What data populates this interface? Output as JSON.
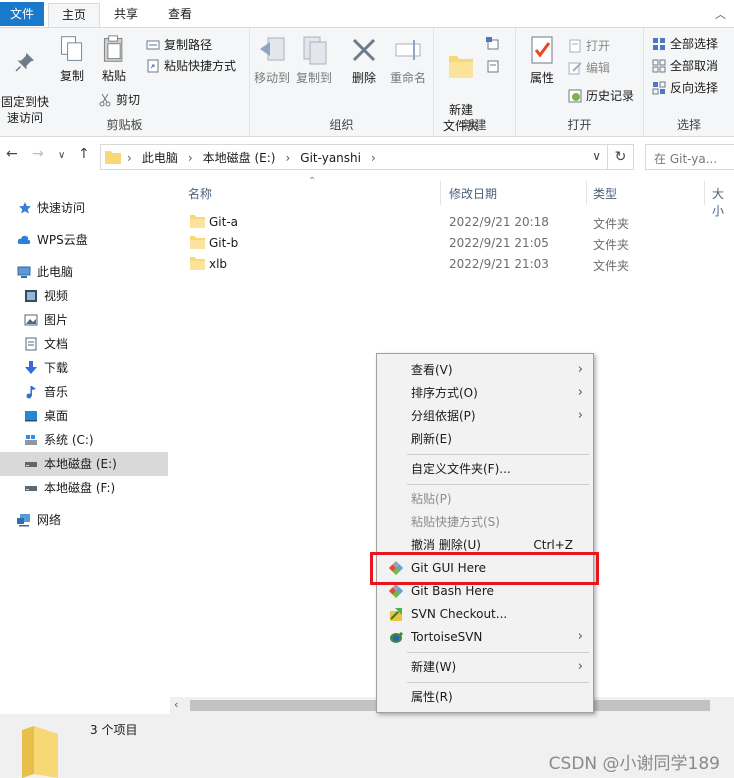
{
  "tabs": {
    "file": "文件",
    "home": "主页",
    "share": "共享",
    "view": "查看"
  },
  "ribbon": {
    "clipboard": {
      "label": "剪贴板",
      "pin": "固定到快\n速访问",
      "copy": "复制",
      "paste": "粘贴",
      "copy_path": "复制路径",
      "paste_shortcut": "粘贴快捷方式",
      "cut": "剪切"
    },
    "organize": {
      "label": "组织",
      "move_to": "移动到",
      "copy_to": "复制到",
      "delete": "删除",
      "rename": "重命名"
    },
    "new": {
      "label": "新建",
      "new_folder": "新建\n文件夹"
    },
    "open": {
      "label": "打开",
      "properties": "属性",
      "open": "打开",
      "edit": "编辑",
      "history": "历史记录"
    },
    "select": {
      "label": "选择",
      "select_all": "全部选择",
      "select_none": "全部取消",
      "invert": "反向选择"
    }
  },
  "address": {
    "crumbs": [
      "此电脑",
      "本地磁盘 (E:)",
      "Git-yanshi"
    ],
    "search_placeholder": "在 Git-ya..."
  },
  "sidebar": {
    "items": [
      {
        "label": "快速访问",
        "icon": "star-icon"
      },
      {
        "label": "WPS云盘",
        "icon": "cloud-icon"
      },
      {
        "label": "此电脑",
        "icon": "computer-icon"
      },
      {
        "label": "视频",
        "icon": "video-icon"
      },
      {
        "label": "图片",
        "icon": "picture-icon"
      },
      {
        "label": "文档",
        "icon": "document-icon"
      },
      {
        "label": "下载",
        "icon": "download-icon"
      },
      {
        "label": "音乐",
        "icon": "music-icon"
      },
      {
        "label": "桌面",
        "icon": "desktop-icon"
      },
      {
        "label": "系统 (C:)",
        "icon": "drive-icon"
      },
      {
        "label": "本地磁盘 (E:)",
        "icon": "drive-icon"
      },
      {
        "label": "本地磁盘 (F:)",
        "icon": "drive-icon"
      },
      {
        "label": "网络",
        "icon": "network-icon"
      }
    ]
  },
  "columns": {
    "name": "名称",
    "date": "修改日期",
    "type": "类型",
    "size": "大小"
  },
  "files": [
    {
      "name": "Git-a",
      "date": "2022/9/21 20:18",
      "type": "文件夹"
    },
    {
      "name": "Git-b",
      "date": "2022/9/21 21:05",
      "type": "文件夹"
    },
    {
      "name": "xlb",
      "date": "2022/9/21 21:03",
      "type": "文件夹"
    }
  ],
  "status": {
    "count": "3 个项目",
    "watermark": "CSDN @小谢同学189"
  },
  "menu": {
    "view": "查看(V)",
    "sort": "排序方式(O)",
    "group": "分组依据(P)",
    "refresh": "刷新(E)",
    "customize": "自定义文件夹(F)...",
    "paste": "粘贴(P)",
    "paste_shortcut": "粘贴快捷方式(S)",
    "undo": "撤消 删除(U)",
    "undo_shortcut": "Ctrl+Z",
    "git_gui": "Git GUI Here",
    "git_bash": "Git Bash Here",
    "svn_checkout": "SVN Checkout...",
    "tortoise": "TortoiseSVN",
    "new": "新建(W)",
    "properties": "属性(R)"
  },
  "colors": {
    "accent": "#1979ca",
    "highlight": "#e8141f",
    "folder": "#f8d775"
  }
}
